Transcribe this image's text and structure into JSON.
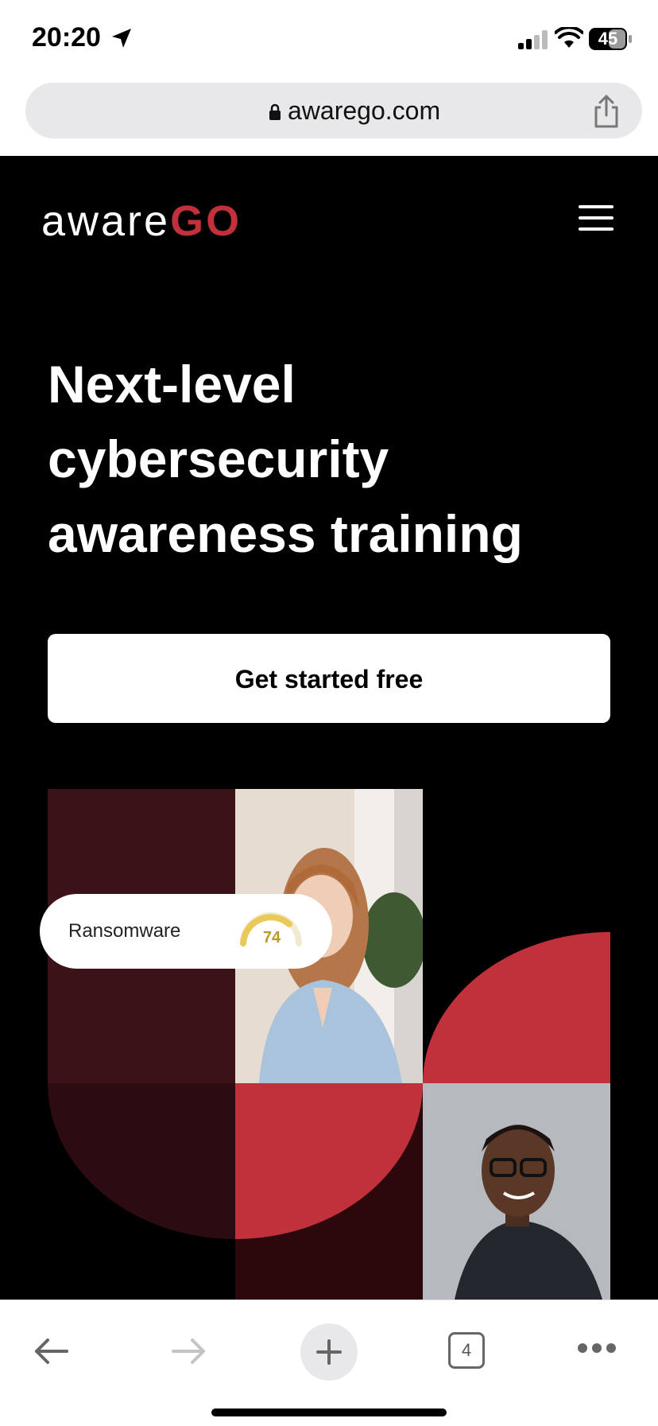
{
  "status_bar": {
    "time": "20:20",
    "battery": "45"
  },
  "browser": {
    "url": "awarego.com"
  },
  "header": {
    "logo_part1": "aware",
    "logo_part2": "GO"
  },
  "hero": {
    "headline_line1": "Next-level",
    "headline_line2": "cybersecurity",
    "headline_line3": "awareness training",
    "cta_label": "Get started free",
    "score_card": {
      "label": "Ransomware",
      "value": "74"
    }
  },
  "toolbar": {
    "tab_count": "4"
  },
  "colors": {
    "brand_red": "#c0313c",
    "dark_maroon": "#3a1218",
    "background": "#000000"
  }
}
